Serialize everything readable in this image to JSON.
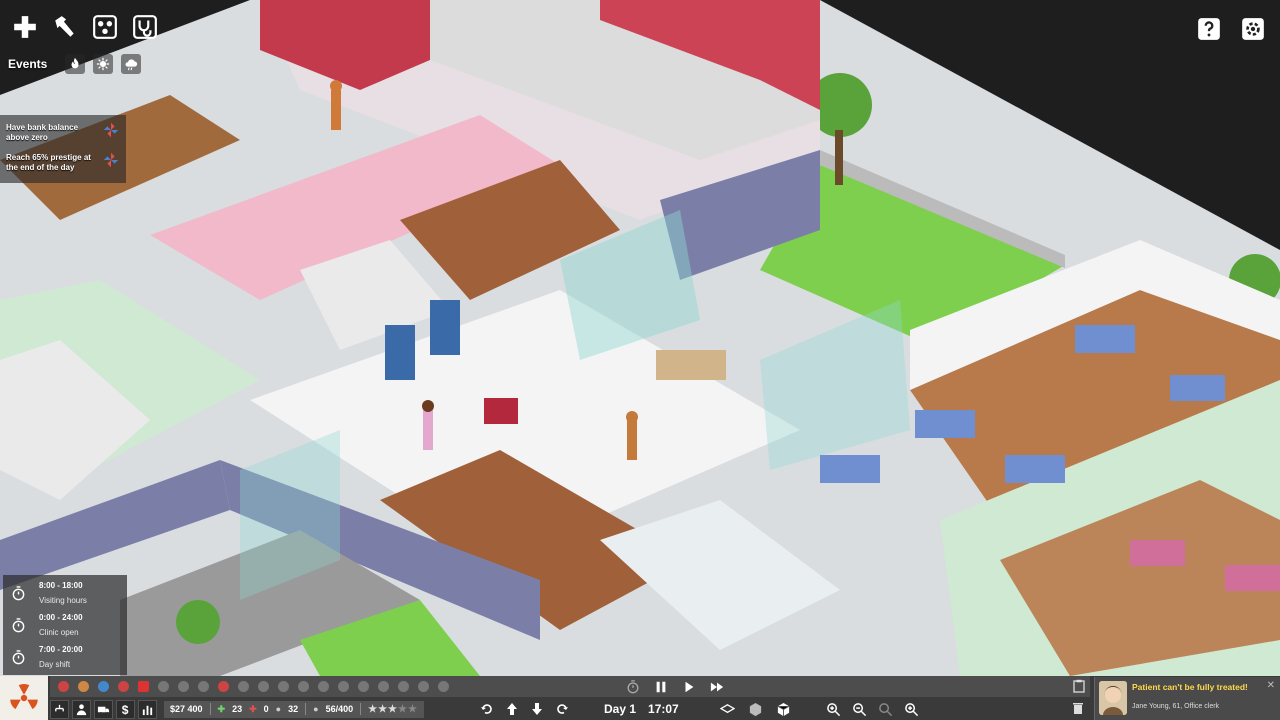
{
  "top_toolbar": {
    "buttons": [
      {
        "name": "build-icon",
        "label": "Build"
      },
      {
        "name": "hammer-icon",
        "label": "Edit"
      },
      {
        "name": "staff-icon",
        "label": "Staff"
      },
      {
        "name": "stethoscope-icon",
        "label": "Medical"
      }
    ],
    "help_icon": "question-icon",
    "settings_icon": "gear-icon"
  },
  "events": {
    "label": "Events",
    "icons": [
      "fire-icon",
      "virus-icon",
      "weather-icon"
    ]
  },
  "goals": [
    {
      "text": "Have bank balance above zero"
    },
    {
      "text": "Reach 65% prestige at the end of the day"
    }
  ],
  "schedule": [
    {
      "time": "8:00 - 18:00",
      "label": "Visiting hours"
    },
    {
      "time": "0:00 - 24:00",
      "label": "Clinic open"
    },
    {
      "time": "7:00 - 20:00",
      "label": "Day shift"
    }
  ],
  "bottom_bar": {
    "money": "$27 400",
    "patients_green": "23",
    "patients_red": "0",
    "staff": "32",
    "capacity": "56/400",
    "prestige_stars": 3,
    "prestige_max": 5,
    "day": "Day 1",
    "time": "17:07",
    "colors": {
      "accent_green": "#6fd36b",
      "alert_red": "#e05050",
      "bar": "#3a3a3a"
    }
  },
  "notification": {
    "title": "Patient can't be fully treated!",
    "subtitle": "Jane Young, 61, Office clerk"
  }
}
